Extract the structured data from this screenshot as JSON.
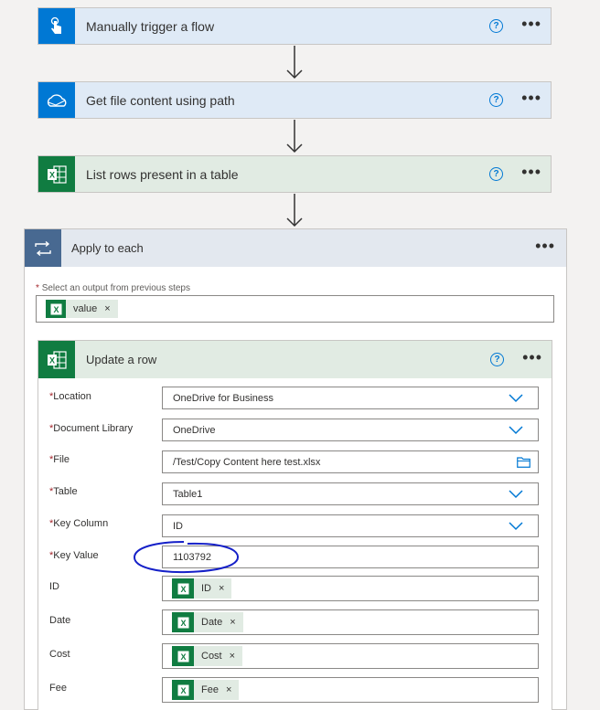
{
  "steps": [
    {
      "title": "Manually trigger a flow",
      "icon": "touch-trigger-icon",
      "color": "#0078d4"
    },
    {
      "title": "Get file content using path",
      "icon": "onedrive-icon",
      "color": "#0078d4"
    },
    {
      "title": "List rows present in a table",
      "icon": "excel-icon",
      "color": "#107c41"
    }
  ],
  "apply": {
    "title": "Apply to each",
    "select_label": "Select an output from previous steps",
    "select_token": "value",
    "update": {
      "title": "Update a row",
      "fields": [
        {
          "label": "Location",
          "value": "OneDrive for Business"
        },
        {
          "label": "Document Library",
          "value": "OneDrive"
        },
        {
          "label": "File",
          "value": "/Test/Copy Content here test.xlsx"
        },
        {
          "label": "Table",
          "value": "Table1"
        },
        {
          "label": "Key Column",
          "value": "ID"
        },
        {
          "label": "Key Value",
          "value": "1103792"
        }
      ],
      "token_fields": [
        {
          "label": "ID",
          "token": "ID"
        },
        {
          "label": "Date",
          "token": "Date"
        },
        {
          "label": "Cost",
          "token": "Cost"
        },
        {
          "label": "Fee",
          "token": "Fee"
        }
      ]
    }
  },
  "required_mark": "*",
  "help_mark": "?",
  "more_mark": "•••",
  "remove_mark": "×"
}
